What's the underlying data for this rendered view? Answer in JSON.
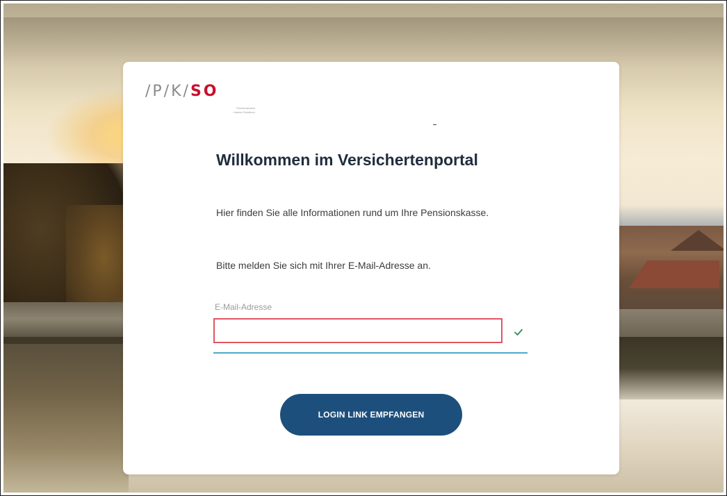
{
  "logo": {
    "slash_part": "/P/K/",
    "so_part": "SO",
    "subtitle_line1": "Pensionskasse",
    "subtitle_line2": "Kanton Solothurn"
  },
  "card": {
    "title": "Willkommen im Versichertenportal",
    "intro": "Hier finden Sie alle Informationen rund um Ihre Pensionskasse.",
    "instruction": "Bitte melden Sie sich mit Ihrer E-Mail-Adresse an."
  },
  "form": {
    "email_label": "E-Mail-Adresse",
    "email_value": "",
    "validation_icon": "check-icon",
    "submit_label": "LOGIN LINK EMPFANGEN"
  },
  "colors": {
    "brand_red": "#c8102e",
    "button_blue": "#1d4f7c",
    "input_error_border": "#e25560",
    "underline_blue": "#4fa6c9",
    "check_green": "#2e8b57"
  }
}
